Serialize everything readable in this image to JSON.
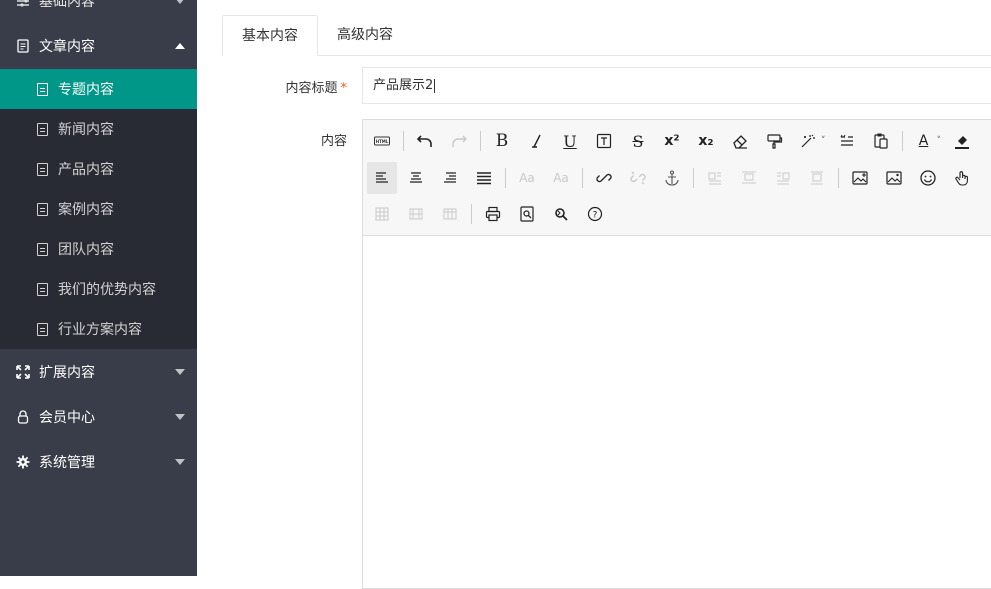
{
  "sidebar": {
    "groups": [
      {
        "label": "基础内容",
        "icon": "sliders-icon",
        "expanded": false
      },
      {
        "label": "文章内容",
        "icon": "document-icon",
        "expanded": true
      },
      {
        "label": "扩展内容",
        "icon": "expand-icon",
        "expanded": false
      },
      {
        "label": "会员中心",
        "icon": "user-icon",
        "expanded": false
      },
      {
        "label": "系统管理",
        "icon": "gear-icon",
        "expanded": false
      }
    ],
    "subitems": [
      {
        "label": "专题内容",
        "active": true
      },
      {
        "label": "新闻内容",
        "active": false
      },
      {
        "label": "产品内容",
        "active": false
      },
      {
        "label": "案例内容",
        "active": false
      },
      {
        "label": "团队内容",
        "active": false
      },
      {
        "label": "我们的优势内容",
        "active": false
      },
      {
        "label": "行业方案内容",
        "active": false
      }
    ],
    "colors": {
      "background": "#393d49",
      "submenu": "#282b33",
      "active": "#009688"
    }
  },
  "tabs": [
    {
      "label": "基本内容",
      "active": true
    },
    {
      "label": "高级内容",
      "active": false
    }
  ],
  "form": {
    "title_label": "内容标题",
    "required_mark": "*",
    "title_value": "产品展示2",
    "content_label": "内容"
  },
  "toolbar": {
    "row1": [
      "html",
      "undo",
      "redo",
      "bold",
      "italic",
      "underline",
      "text-box",
      "strikethrough",
      "superscript",
      "subscript",
      "eraser",
      "format-paint",
      "magic",
      "blockquote",
      "paste",
      "font-color",
      "bg-color"
    ],
    "row2": [
      "align-left",
      "align-center",
      "align-right",
      "align-justify",
      "font-bigger",
      "font-smaller",
      "link",
      "unlink",
      "anchor",
      "image-left",
      "image-none",
      "image-right",
      "image-center",
      "insert-image",
      "insert-image-2",
      "emoji",
      "touch"
    ],
    "row3": [
      "table",
      "table-row",
      "table-col",
      "print",
      "preview",
      "search-replace",
      "help"
    ]
  }
}
